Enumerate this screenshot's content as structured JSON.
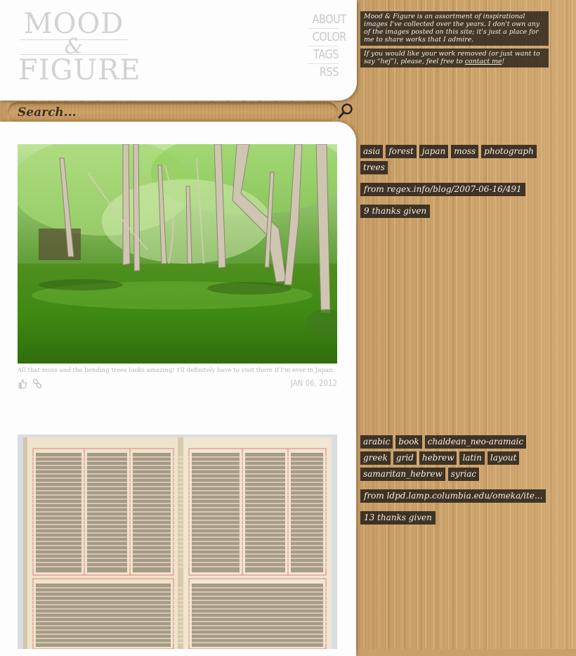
{
  "logo": {
    "line1": "MOOD",
    "line2": "&",
    "line3": "FIGURE"
  },
  "nav": [
    {
      "label": "ABOUT"
    },
    {
      "label": "COLOR"
    },
    {
      "label": "TAGS"
    },
    {
      "label": "RSS"
    }
  ],
  "search": {
    "placeholder": "Search..."
  },
  "about": {
    "p1": "Mood & Figure is an assortment of inspirational images I've collected over the years. I don't own any of the images posted on this site; it's just a place for me to share works that I admire.",
    "p2_prefix": "If you would like your work removed (or just want to say “hej”), please, feel free to ",
    "p2_link": "contact me",
    "p2_suffix": "!"
  },
  "posts": [
    {
      "image": "forest-moss-photo",
      "caption": "All that moss and the bending trees looks amazing! I'll definitely have to visit there if I'm ever in Japan.",
      "date": "JAN 06, 2012",
      "tags": [
        "asia",
        "forest",
        "japan",
        "moss",
        "photograph",
        "trees"
      ],
      "source": "from regex.info/blog/2007-06-16/491",
      "thanks": "9 thanks given"
    },
    {
      "image": "polyglot-book-photo",
      "tags": [
        "arabic",
        "book",
        "chaldean_neo-aramaic",
        "greek",
        "grid",
        "hebrew",
        "latin",
        "layout",
        "samaritan_hebrew",
        "syriac"
      ],
      "source": "from ldpd.lamp.columbia.edu/omeka/ite...",
      "thanks": "13 thanks given"
    }
  ],
  "colors": {
    "panel": "#fdfdfd",
    "tag_bg": "#28211a",
    "tag_text": "#f4efe6",
    "logo": "#d2d2d2",
    "wood": "#c9a06a"
  }
}
